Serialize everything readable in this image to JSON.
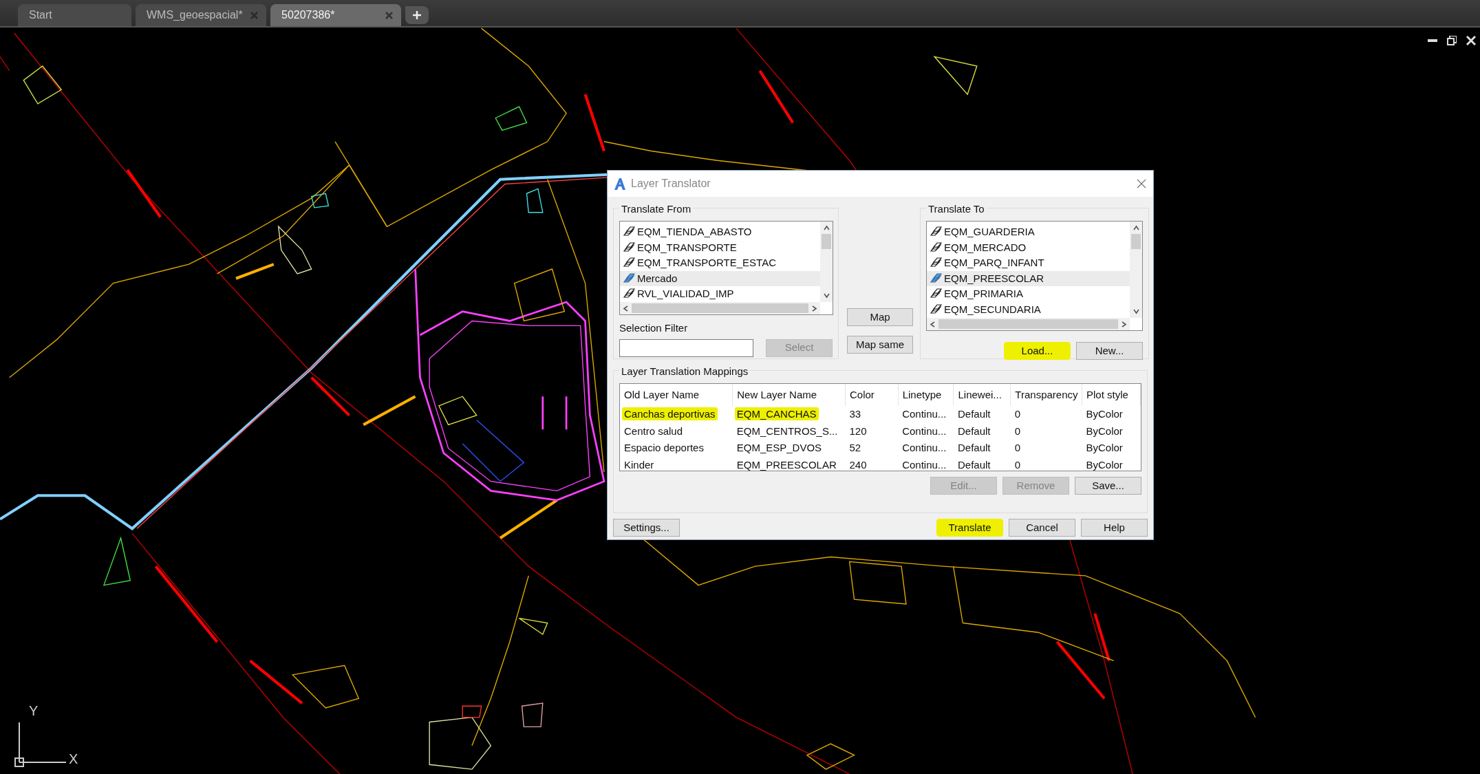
{
  "tabs": [
    {
      "label": "Start",
      "selected": false,
      "closable": false
    },
    {
      "label": "WMS_geoespacial*",
      "selected": false,
      "closable": true
    },
    {
      "label": "50207386*",
      "selected": true,
      "closable": true
    }
  ],
  "dialog": {
    "title": "Layer Translator",
    "translate_from": {
      "title": "Translate From",
      "items": [
        {
          "label": "EQM_TIENDA_ABASTO",
          "selected": false
        },
        {
          "label": "EQM_TRANSPORTE",
          "selected": false
        },
        {
          "label": "EQM_TRANSPORTE_ESTAC",
          "selected": false
        },
        {
          "label": "Mercado",
          "selected": true
        },
        {
          "label": "RVL_VIALIDAD_IMP",
          "selected": false
        }
      ],
      "filter_label": "Selection Filter",
      "button": {
        "label": "Select",
        "disabled": true,
        "highlighted": false
      }
    },
    "map_buttons": [
      {
        "label": "Map",
        "disabled": false,
        "highlighted": false
      },
      {
        "label": "Map same",
        "disabled": false,
        "highlighted": false
      }
    ],
    "translate_to": {
      "title": "Translate To",
      "items": [
        {
          "label": "EQM_GUARDERIA",
          "selected": false
        },
        {
          "label": "EQM_MERCADO",
          "selected": false
        },
        {
          "label": "EQM_PARQ_INFANT",
          "selected": false
        },
        {
          "label": "EQM_PREESCOLAR",
          "selected": true
        },
        {
          "label": "EQM_PRIMARIA",
          "selected": false
        },
        {
          "label": "EQM_SECUNDARIA",
          "selected": false
        }
      ],
      "buttons": [
        {
          "label": "Load...",
          "disabled": false,
          "highlighted": true
        },
        {
          "label": "New...",
          "disabled": false,
          "highlighted": false
        }
      ]
    },
    "mappings": {
      "title": "Layer Translation Mappings",
      "columns": [
        "Old Layer Name",
        "New Layer Name",
        "Color",
        "Linetype",
        "Linewei...",
        "Transparency",
        "Plot style"
      ],
      "rows": [
        {
          "cells": [
            {
              "text": "Canchas deportivas",
              "highlighted": true
            },
            {
              "text": "EQM_CANCHAS",
              "highlighted": true
            },
            {
              "text": "33",
              "highlighted": false
            },
            {
              "text": "Continu...",
              "highlighted": false
            },
            {
              "text": "Default",
              "highlighted": false
            },
            {
              "text": "0",
              "highlighted": false
            },
            {
              "text": "ByColor",
              "highlighted": false
            }
          ]
        },
        {
          "cells": [
            {
              "text": "Centro salud",
              "highlighted": false
            },
            {
              "text": "EQM_CENTROS_S...",
              "highlighted": false
            },
            {
              "text": "120",
              "highlighted": false
            },
            {
              "text": "Continu...",
              "highlighted": false
            },
            {
              "text": "Default",
              "highlighted": false
            },
            {
              "text": "0",
              "highlighted": false
            },
            {
              "text": "ByColor",
              "highlighted": false
            }
          ]
        },
        {
          "cells": [
            {
              "text": "Espacio deportes",
              "highlighted": false
            },
            {
              "text": "EQM_ESP_DVOS",
              "highlighted": false
            },
            {
              "text": "52",
              "highlighted": false
            },
            {
              "text": "Continu...",
              "highlighted": false
            },
            {
              "text": "Default",
              "highlighted": false
            },
            {
              "text": "0",
              "highlighted": false
            },
            {
              "text": "ByColor",
              "highlighted": false
            }
          ]
        },
        {
          "cells": [
            {
              "text": "Kinder",
              "highlighted": false
            },
            {
              "text": "EQM_PREESCOLAR",
              "highlighted": false
            },
            {
              "text": "240",
              "highlighted": false
            },
            {
              "text": "Continu...",
              "highlighted": false
            },
            {
              "text": "Default",
              "highlighted": false
            },
            {
              "text": "0",
              "highlighted": false
            },
            {
              "text": "ByColor",
              "highlighted": false
            }
          ]
        }
      ],
      "buttons": [
        {
          "label": "Edit...",
          "disabled": true,
          "highlighted": false
        },
        {
          "label": "Remove",
          "disabled": true,
          "highlighted": false
        },
        {
          "label": "Save...",
          "disabled": false,
          "highlighted": false
        }
      ]
    },
    "footer_left": {
      "label": "Settings...",
      "disabled": false,
      "highlighted": false
    },
    "footer_buttons": [
      {
        "label": "Translate",
        "disabled": false,
        "highlighted": true
      },
      {
        "label": "Cancel",
        "disabled": false,
        "highlighted": false
      },
      {
        "label": "Help",
        "disabled": false,
        "highlighted": false
      }
    ]
  },
  "ucs_icon": {
    "y_label": "Y",
    "x_label": "X"
  }
}
